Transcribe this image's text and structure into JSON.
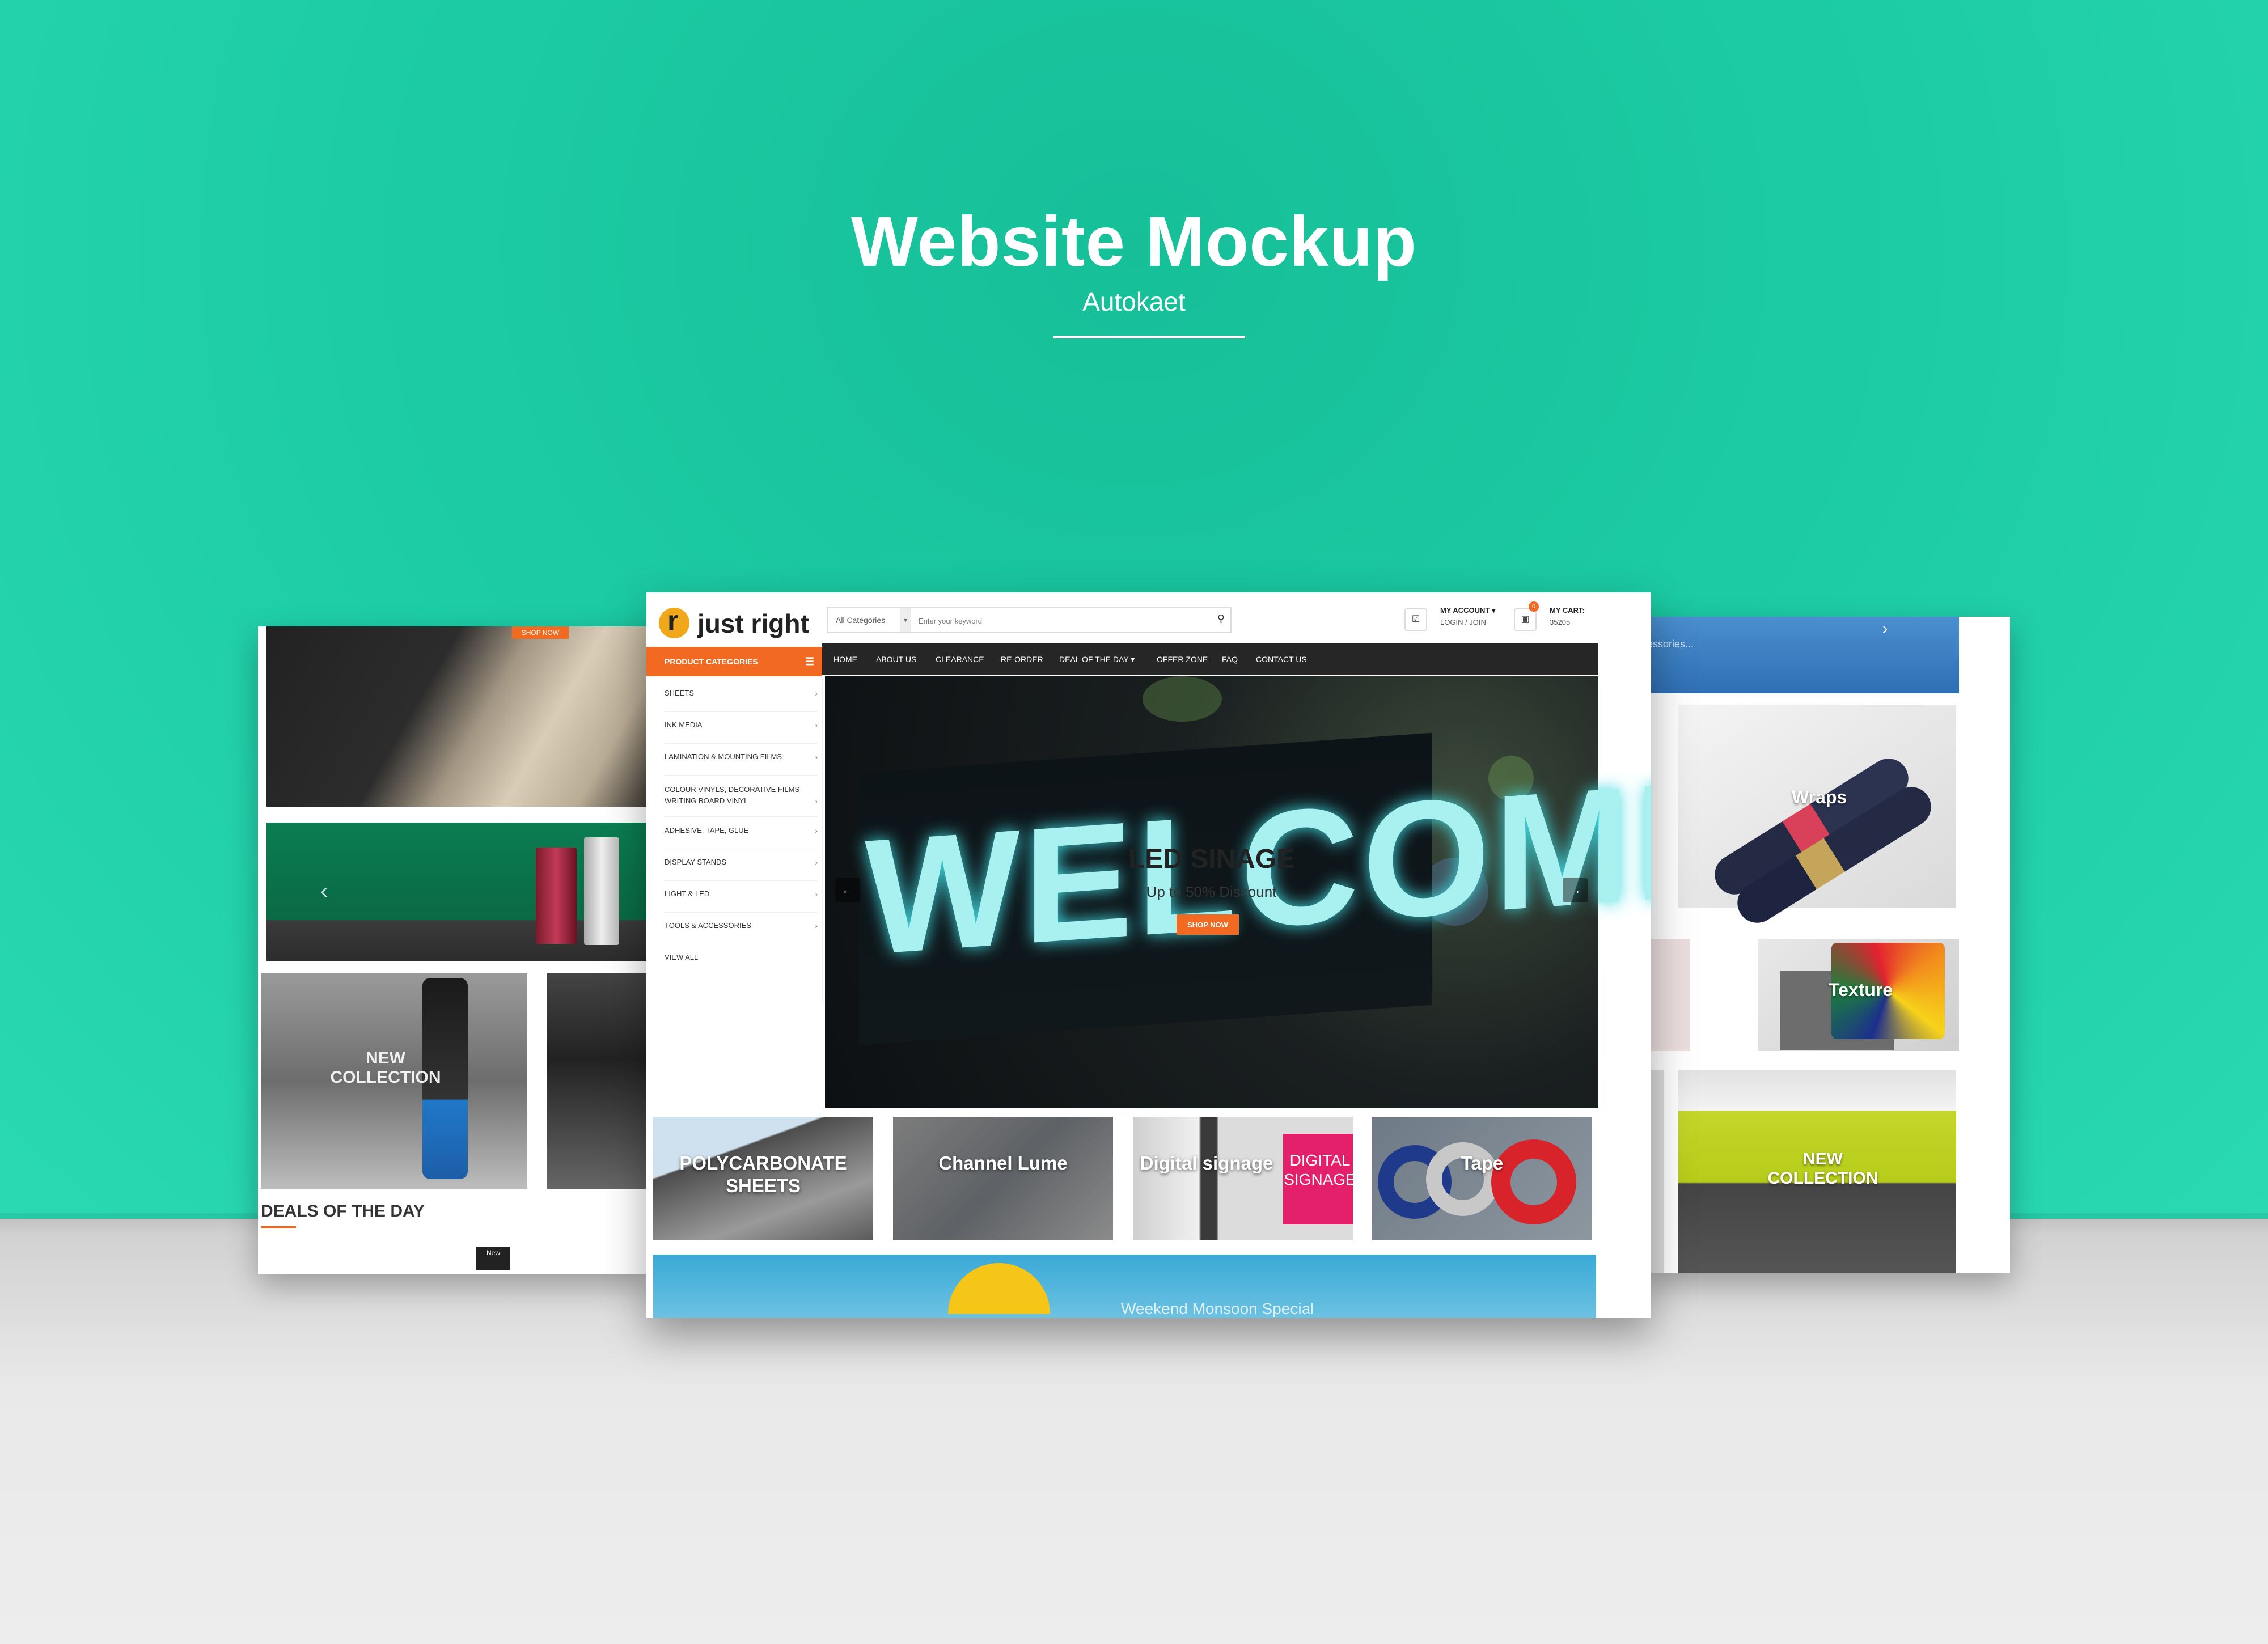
{
  "mockup": {
    "title": "Website Mockup",
    "subtitle": "Autokaet"
  },
  "left_screen": {
    "shop_now": "SHOP NOW",
    "collection_label": "NEW COLLECTION",
    "deals_heading": "DEALS OF THE DAY",
    "new_badge": "New"
  },
  "right_screen": {
    "top_text": "essories...",
    "wraps_label": "Wraps",
    "texture_label": "Texture",
    "collection_label": "NEW COLLECTION"
  },
  "site": {
    "logo": "just right",
    "search": {
      "category": "All Categories",
      "placeholder": "Enter your keyword"
    },
    "account": {
      "label": "MY ACCOUNT ▾",
      "sub": "LOGIN / JOIN"
    },
    "cart": {
      "label": "MY CART:",
      "amount": "35205",
      "count": "0"
    },
    "categories_heading": "PRODUCT CATEGORIES",
    "categories": [
      "SHEETS",
      "INK MEDIA",
      "LAMINATION & MOUNTING FILMS",
      "COLOUR VINYLS, DECORATIVE FILMS WRITING BOARD VINYL",
      "ADHESIVE, TAPE, GLUE",
      "DISPLAY STANDS",
      "LIGHT & LED",
      "TOOLS & ACCESSORIES",
      "VIEW ALL"
    ],
    "nav": [
      "HOME",
      "ABOUT US",
      "CLEARANCE",
      "RE-ORDER",
      "DEAL OF THE DAY ▾",
      "OFFER ZONE",
      "FAQ",
      "CONTACT US"
    ],
    "hero": {
      "sign_text": "WELCOME",
      "title": "LED SINAGE",
      "subtitle": "Up to 50% Discount",
      "button": "SHOP NOW"
    },
    "tiles": [
      "POLYCARBONATE SHEETS",
      "Channel Lume",
      "Digital signage",
      "Tape"
    ],
    "digital_signage_sign": "DIGITAL SIGNAGE",
    "banner_text": "Weekend Monsoon Special"
  },
  "colors": {
    "accent": "#f26a21",
    "background": "#1ccba4",
    "nav": "#262626"
  }
}
